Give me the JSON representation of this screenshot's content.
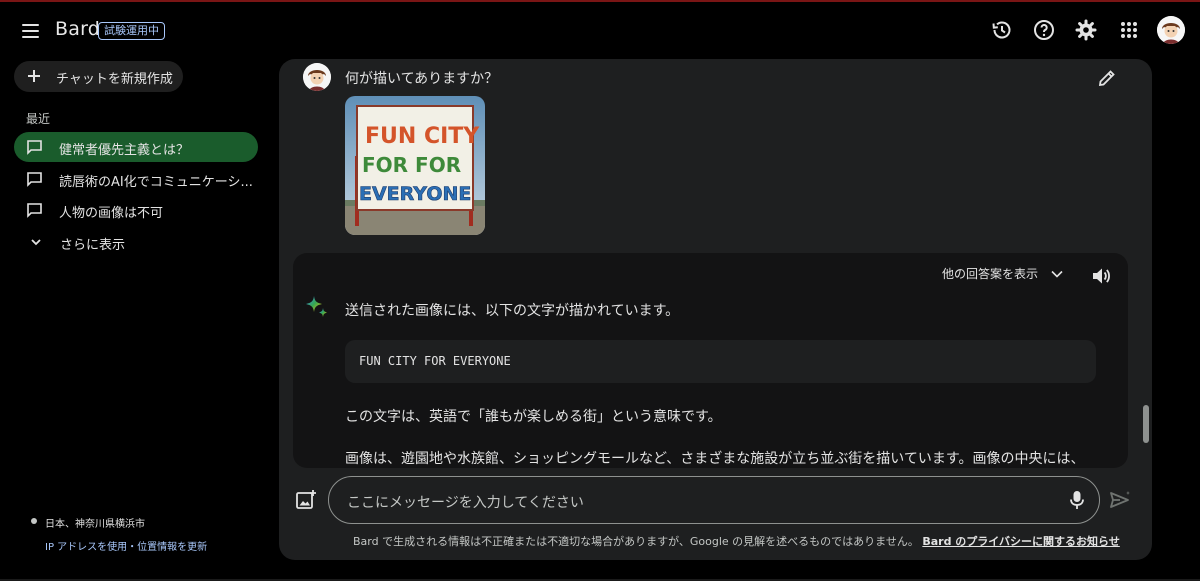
{
  "header": {
    "app_name": "Bard",
    "badge": "試験運用中",
    "icons": [
      "menu-icon",
      "history-icon",
      "help-icon",
      "gear-icon",
      "apps-grid-icon",
      "avatar"
    ]
  },
  "sidebar": {
    "new_chat_label": "チャットを新規作成",
    "recent_heading": "最近",
    "items": [
      {
        "label": "健常者優先主義とは？",
        "active": true
      },
      {
        "label": "読唇術のAI化でコミュニケーシ...",
        "active": false
      },
      {
        "label": "人物の画像は不可",
        "active": false
      }
    ],
    "show_more_label": "さらに表示",
    "location": "日本、神奈川県横浜市",
    "location_link": "IP アドレスを使用・位置情報を更新"
  },
  "conversation": {
    "user_prompt": "何が描いてありますか？",
    "image_text_lines": [
      "FUN CITY",
      "FOR FOR",
      "EVERYONE"
    ],
    "other_drafts_label": "他の回答案を表示",
    "response_intro": "送信された画像には、以下の文字が描かれています。",
    "code_text": "FUN CITY FOR EVERYONE",
    "response_p2": "この文字は、英語で「誰もが楽しめる街」という意味です。",
    "response_p3": "画像は、遊園地や水族館、ショッピングモールなど、さまざまな施設が立ち並ぶ街を描いています。画像の中央には、"
  },
  "composer": {
    "placeholder": "ここにメッセージを入力してください",
    "disclaimer": "Bard で生成される情報は不正確または不適切な場合がありますが、Google の見解を述べるものではありません。",
    "privacy_link": "Bard のプライバシーに関するお知らせ"
  },
  "colors": {
    "background": "#000000",
    "panel": "#1e1f20",
    "response_card": "#131314",
    "active_item": "#1a5c2c",
    "badge": "#a8c7fa",
    "sparkle_gradient": [
      "#4285f4",
      "#34a853",
      "#fbbc04"
    ]
  }
}
